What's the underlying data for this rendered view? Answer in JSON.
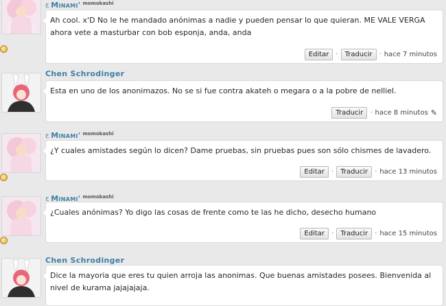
{
  "comments": [
    {
      "author": "Minami'",
      "author_tag": "momokashi",
      "author_style": "smallcaps",
      "text": "Ah cool. x'D No le he mandado anónimas a nadie y pueden pensar lo que quieran. ME VALE VERGA ahora vete a masturbar con bob esponja, anda, anda",
      "edit_label": "Editar",
      "translate_label": "Traducir",
      "time": "hace 7 minutos"
    },
    {
      "author": "Chen Schrodinger",
      "text": "Esta en uno de los anonimazos. No se si fue contra akateh o megara o a la pobre de nelliel.",
      "translate_label": "Traducir",
      "time": "hace 8 minutos"
    },
    {
      "author": "Minami'",
      "author_tag": "momokashi",
      "text": "¿Y cuales amistades según lo dicen? Dame pruebas, sin pruebas pues son sólo chismes de lavadero.",
      "edit_label": "Editar",
      "translate_label": "Traducir",
      "time": "hace 13 minutos"
    },
    {
      "author": "Minami'",
      "author_tag": "momokashi",
      "text": "¿Cuales anónimas? Yo digo las cosas de frente como te las he dicho, desecho humano",
      "edit_label": "Editar",
      "translate_label": "Traducir",
      "time": "hace 15 minutos"
    },
    {
      "author": "Chen Schrodinger",
      "text": "Dice la mayoria que eres tu quien arroja las anonimas. Que buenas amistades posees. Bienvenida al nivel de kurama jajajajaja."
    }
  ],
  "separator": "·",
  "icons": {
    "name_prefix": "ε",
    "pencil": "✎"
  },
  "colors": {
    "author": "#3f7fa6",
    "background": "#e9e9e9",
    "bubble": "#ffffff"
  }
}
